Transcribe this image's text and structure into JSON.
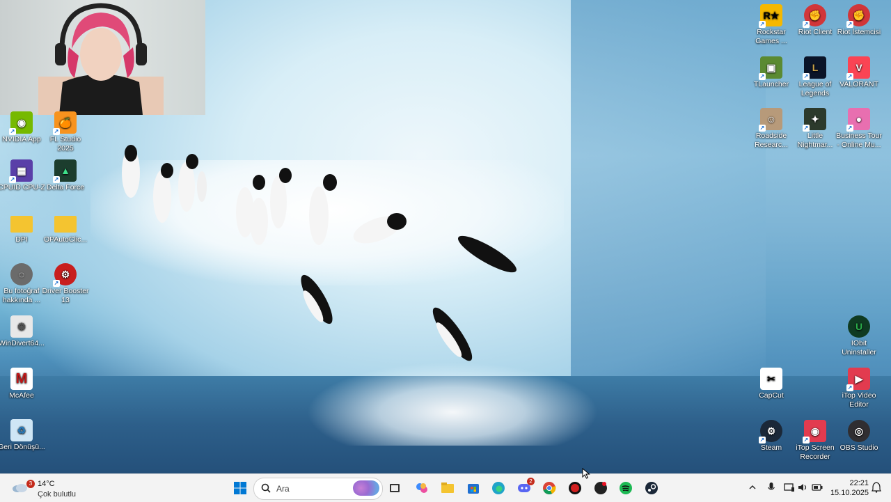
{
  "desktop": {
    "left_icons": [
      {
        "name": "nvidia-app-icon",
        "label": "NVIDIA App",
        "color": "#76b900"
      },
      {
        "name": "fl-studio-icon",
        "label": "FL Studio 2025",
        "color": "#f7931e"
      },
      {
        "name": "cpuid-icon",
        "label": "CPUID CPU-Z",
        "color": "#5a3fa8"
      },
      {
        "name": "delta-force-icon",
        "label": "Delta Force",
        "color": "#1c3d2e"
      },
      {
        "name": "folder-icon",
        "label": "DPI",
        "color": "#f4c430"
      },
      {
        "name": "folder-icon",
        "label": "OPAutoClic...",
        "color": "#f4c430"
      },
      {
        "name": "photo-info-icon",
        "label": "Bu fotoğraf hakkında ...",
        "color": "#6b6b6b"
      },
      {
        "name": "driver-booster-icon",
        "label": "Driver Booster 13",
        "color": "#c81e1e"
      },
      {
        "name": "file-icon",
        "label": "WinDivert64...",
        "color": "#e8e8e8"
      },
      {
        "name": "mcafee-icon",
        "label": "McAfee",
        "color": "#c01818"
      },
      {
        "name": "recycle-bin-icon",
        "label": "Geri Dönüşü...",
        "color": "#cfe6f5"
      }
    ],
    "right_icons": [
      {
        "name": "rockstar-icon",
        "label": "Rockstar Games ...",
        "color": "#f5b800"
      },
      {
        "name": "riot-client-icon",
        "label": "Riot Client",
        "color": "#d13639"
      },
      {
        "name": "riot-istemcisi-icon",
        "label": "Riot İstemcisi",
        "color": "#d13639"
      },
      {
        "name": "tlauncher-icon",
        "label": "TLauncher",
        "color": "#5b8a32"
      },
      {
        "name": "league-icon",
        "label": "League of Legends",
        "color": "#c8a24a"
      },
      {
        "name": "valorant-icon",
        "label": "VALORANT",
        "color": "#fa4454"
      },
      {
        "name": "roadside-icon",
        "label": "Roadside Researc...",
        "color": "#b79a7a"
      },
      {
        "name": "little-nightmares-icon",
        "label": "Little Nightmar...",
        "color": "#2c3a2c"
      },
      {
        "name": "business-tour-icon",
        "label": "Business Tour - Online Mu...",
        "color": "#e86fb0"
      },
      {
        "name": "iobit-uninstaller-icon",
        "label": "IObit Uninstaller",
        "color": "#2bb24c"
      },
      {
        "name": "capcut-icon",
        "label": "CapCut",
        "color": "#ffffff"
      },
      {
        "name": "itop-video-icon",
        "label": "iTop Video Editor",
        "color": "#e23b4f"
      },
      {
        "name": "steam-icon",
        "label": "Steam",
        "color": "#1b2838"
      },
      {
        "name": "itop-screen-icon",
        "label": "iTop Screen Recorder",
        "color": "#e23b4f"
      },
      {
        "name": "obs-icon",
        "label": "OBS Studio",
        "color": "#302e31"
      }
    ]
  },
  "taskbar": {
    "weather": {
      "temp": "14°C",
      "condition": "Çok bulutlu",
      "badge": "3"
    },
    "search_placeholder": "Ara",
    "discord_badge": "2",
    "clock_time": "22:21",
    "clock_date": "15.10.2025"
  }
}
